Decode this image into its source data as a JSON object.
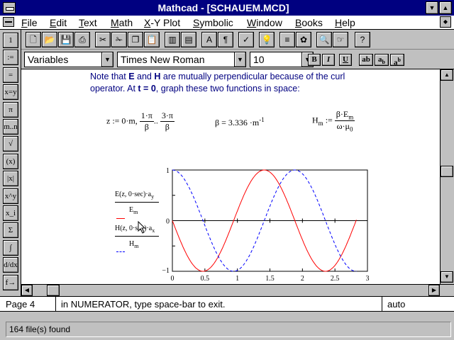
{
  "window": {
    "title": "Mathcad - [SCHAUEM.MCD]"
  },
  "menu": [
    {
      "label": "File",
      "u": "F",
      "rest": "ile"
    },
    {
      "label": "Edit",
      "u": "E",
      "rest": "dit"
    },
    {
      "label": "Text",
      "u": "T",
      "rest": "ext"
    },
    {
      "label": "Math",
      "u": "M",
      "rest": "ath"
    },
    {
      "label": "X-Y Plot",
      "u": "X",
      "rest": "-Y Plot"
    },
    {
      "label": "Symbolic",
      "u": "S",
      "rest": "ymbolic"
    },
    {
      "label": "Window",
      "u": "W",
      "rest": "indow"
    },
    {
      "label": "Books",
      "u": "B",
      "rest": "ooks"
    },
    {
      "label": "Help",
      "u": "H",
      "rest": "elp"
    }
  ],
  "format": {
    "style": "Variables",
    "font": "Times New Roman",
    "size": "10",
    "bold": "B",
    "italic": "I",
    "underline": "U",
    "btn_ab": "ab",
    "btn_ab_sub": "a",
    "btn_ab_sub_s": "b",
    "btn_ab_sup": "a",
    "btn_ab_sup_s": "b"
  },
  "palette": [
    {
      "name": "one",
      "label": "1"
    },
    {
      "name": "assign-list",
      "label": ":="
    },
    {
      "name": "equal",
      "label": "="
    },
    {
      "name": "xy-equal",
      "label": "x=y"
    },
    {
      "name": "pi",
      "label": "π"
    },
    {
      "name": "range",
      "label": "m..n"
    },
    {
      "name": "sqrt",
      "label": "√"
    },
    {
      "name": "paren",
      "label": "(x)"
    },
    {
      "name": "abs",
      "label": "|x|"
    },
    {
      "name": "power",
      "label": "x^y"
    },
    {
      "name": "subscript",
      "label": "x_i"
    },
    {
      "name": "sum",
      "label": "Σ"
    },
    {
      "name": "integral",
      "label": "∫"
    },
    {
      "name": "derivative",
      "label": "d/dx"
    },
    {
      "name": "expand",
      "label": "f→"
    }
  ],
  "document": {
    "note_line1_a": "Note that ",
    "note_E": "E",
    "note_and": " and ",
    "note_H": "H",
    "note_line1_b": " are mutually perpendicular because of the curl",
    "note_line2_a": "operator.  At ",
    "note_t": "t = 0",
    "note_line2_b": ", graph these two functions in space:",
    "eq_z_lhs": "z := 0·m,",
    "eq_z_f1_num": "1·π",
    "eq_z_f1_den": "β",
    "eq_z_dots": "..",
    "eq_z_f2_num": "3·π",
    "eq_z_f2_den": "β",
    "eq_beta": "β = 3.336 ·m",
    "eq_beta_exp": "-1",
    "eq_H_lhs": "H",
    "eq_H_sub": "m",
    "eq_H_assign": ":=",
    "eq_H_num": "β·E",
    "eq_H_num_sub": "m",
    "eq_H_den": "ω·μ",
    "eq_H_den_sub": "0"
  },
  "plot": {
    "y1_num": "E(z, 0·sec)·a",
    "y1_num_sub": "y",
    "y1_den": "E",
    "y1_den_sub": "m",
    "y2_num": "H(z, 0·sec)·a",
    "y2_num_sub": "x",
    "y2_den": "H",
    "y2_den_sub": "m",
    "y_max": "1",
    "y_zero": "0",
    "y_min": "−1",
    "x_ticks": [
      "0",
      "0.5",
      "1",
      "1.5",
      "2",
      "2.5",
      "3"
    ]
  },
  "chart_data": {
    "type": "line",
    "x_range": [
      0,
      2.83
    ],
    "ylim": [
      -1,
      1
    ],
    "xticks": [
      0,
      0.5,
      1,
      1.5,
      2,
      2.5,
      3
    ],
    "series": [
      {
        "function": "E(z,0)/Em = -sin(beta*z)",
        "color": "#ff0000",
        "style": "solid"
      },
      {
        "function": "H(z,0)/Hm = cos(beta*z)",
        "color": "#0000ff",
        "style": "dashed"
      }
    ],
    "beta": 3.336
  },
  "status": {
    "page": "Page 4",
    "message": "in NUMERATOR, type space-bar to exit.",
    "mode": "auto"
  },
  "footer": {
    "found": "164 file(s) found"
  }
}
